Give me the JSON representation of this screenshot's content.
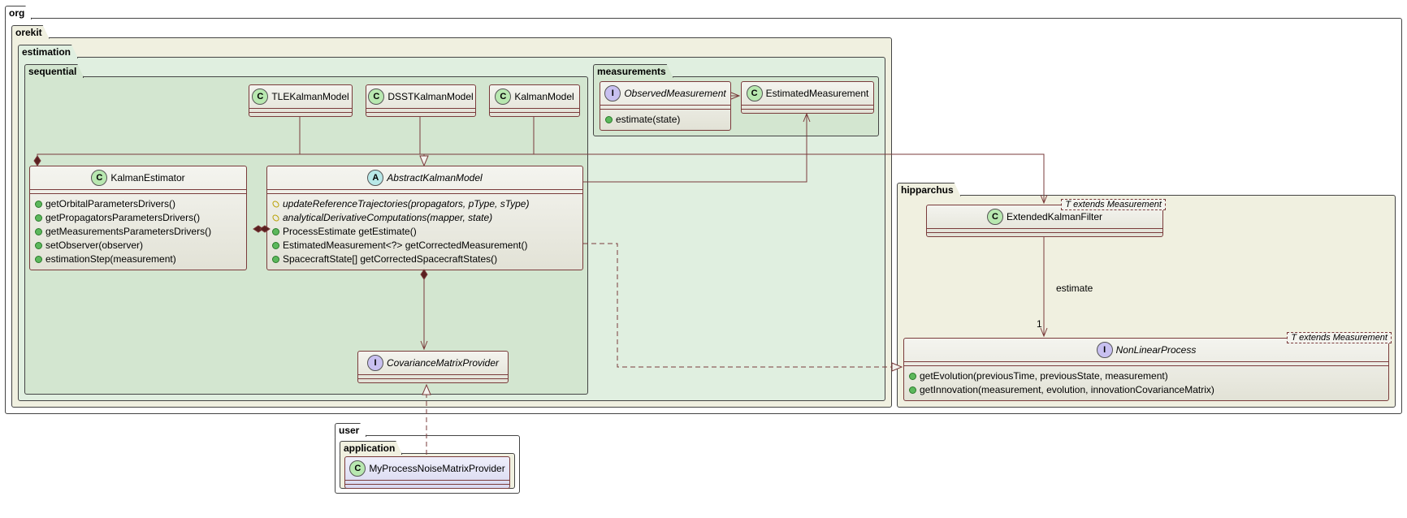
{
  "packages": {
    "org": "org",
    "orekit": "orekit",
    "estimation": "estimation",
    "sequential": "sequential",
    "measurements": "measurements",
    "hipparchus": "hipparchus",
    "user": "user",
    "application": "application"
  },
  "classes": {
    "tleKalmanModel": {
      "name": "TLEKalmanModel",
      "stereo": "C"
    },
    "dsstKalmanModel": {
      "name": "DSSTKalmanModel",
      "stereo": "C"
    },
    "kalmanModel": {
      "name": "KalmanModel",
      "stereo": "C"
    },
    "kalmanEstimator": {
      "name": "KalmanEstimator",
      "stereo": "C",
      "members": [
        "getOrbitalParametersDrivers()",
        "getPropagatorsParametersDrivers()",
        "getMeasurementsParametersDrivers()",
        "setObserver(observer)",
        "estimationStep(measurement)"
      ]
    },
    "abstractKalmanModel": {
      "name": "AbstractKalmanModel",
      "stereo": "A",
      "members_abs": [
        "updateReferenceTrajectories(propagators, pType, sType)",
        "analyticalDerivativeComputations(mapper, state)"
      ],
      "members": [
        "ProcessEstimate getEstimate()",
        "EstimatedMeasurement<?> getCorrectedMeasurement()",
        "SpacecraftState[] getCorrectedSpacecraftStates()"
      ]
    },
    "covarianceMatrixProvider": {
      "name": "CovarianceMatrixProvider",
      "stereo": "I"
    },
    "observedMeasurement": {
      "name": "ObservedMeasurement",
      "stereo": "I",
      "members": [
        "estimate(state)"
      ]
    },
    "estimatedMeasurement": {
      "name": "EstimatedMeasurement",
      "stereo": "C"
    },
    "extendedKalmanFilter": {
      "name": "ExtendedKalmanFilter",
      "stereo": "C",
      "generic": "T extends Measurement"
    },
    "nonLinearProcess": {
      "name": "NonLinearProcess",
      "stereo": "I",
      "generic": "T extends Measurement",
      "members": [
        "getEvolution(previousTime, previousState, measurement)",
        "getInnovation(measurement, evolution, innovationCovarianceMatrix)"
      ]
    },
    "myProcessNoiseMatrixProvider": {
      "name": "MyProcessNoiseMatrixProvider",
      "stereo": "C"
    }
  },
  "labels": {
    "estimate": "estimate",
    "one": "1"
  },
  "chart_data": {
    "type": "uml_class_diagram",
    "packages": [
      {
        "name": "org",
        "children": [
          {
            "name": "orekit",
            "children": [
              {
                "name": "estimation",
                "children": [
                  {
                    "name": "sequential",
                    "classes": [
                      "TLEKalmanModel",
                      "DSSTKalmanModel",
                      "KalmanModel",
                      "KalmanEstimator",
                      "AbstractKalmanModel",
                      "CovarianceMatrixProvider"
                    ]
                  },
                  {
                    "name": "measurements",
                    "classes": [
                      "ObservedMeasurement",
                      "EstimatedMeasurement"
                    ]
                  }
                ]
              }
            ]
          },
          {
            "name": "hipparchus",
            "classes": [
              "ExtendedKalmanFilter",
              "NonLinearProcess"
            ]
          }
        ]
      },
      {
        "name": "user",
        "children": [
          {
            "name": "application",
            "classes": [
              "MyProcessNoiseMatrixProvider"
            ]
          }
        ]
      }
    ],
    "relationships": [
      {
        "from": "TLEKalmanModel",
        "to": "AbstractKalmanModel",
        "type": "generalization"
      },
      {
        "from": "DSSTKalmanModel",
        "to": "AbstractKalmanModel",
        "type": "generalization"
      },
      {
        "from": "KalmanModel",
        "to": "AbstractKalmanModel",
        "type": "generalization"
      },
      {
        "from": "KalmanEstimator",
        "to": "AbstractKalmanModel",
        "type": "composition-bidir"
      },
      {
        "from": "KalmanEstimator",
        "to": "ExtendedKalmanFilter",
        "type": "composition"
      },
      {
        "from": "AbstractKalmanModel",
        "to": "CovarianceMatrixProvider",
        "type": "composition"
      },
      {
        "from": "AbstractKalmanModel",
        "to": "EstimatedMeasurement",
        "type": "dependency"
      },
      {
        "from": "AbstractKalmanModel",
        "to": "NonLinearProcess",
        "type": "realization"
      },
      {
        "from": "ObservedMeasurement",
        "to": "EstimatedMeasurement",
        "type": "dependency-create"
      },
      {
        "from": "ExtendedKalmanFilter",
        "to": "NonLinearProcess",
        "type": "association",
        "label": "estimate",
        "multiplicity": "1"
      },
      {
        "from": "MyProcessNoiseMatrixProvider",
        "to": "CovarianceMatrixProvider",
        "type": "realization"
      }
    ]
  }
}
